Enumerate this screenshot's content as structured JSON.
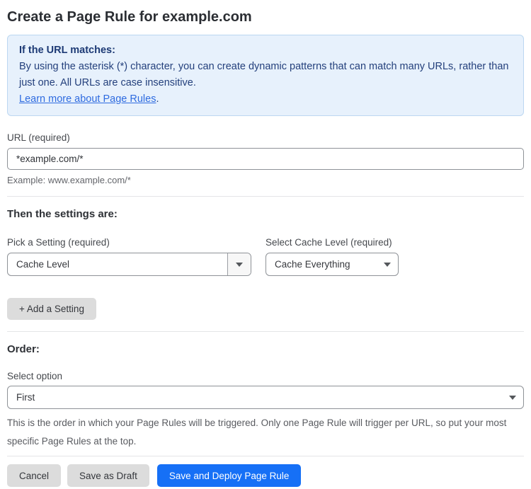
{
  "page": {
    "title": "Create a Page Rule for example.com"
  },
  "info_box": {
    "heading": "If the URL matches:",
    "body": "By using the asterisk (*) character, you can create dynamic patterns that can match many URLs, rather than just one. All URLs are case insensitive.",
    "link_label": "Learn more about Page Rules",
    "link_suffix": "."
  },
  "url_field": {
    "label": "URL (required)",
    "value": "*example.com/*",
    "helper": "Example: www.example.com/*"
  },
  "settings_section": {
    "heading": "Then the settings are:",
    "setting_picker": {
      "label": "Pick a Setting (required)",
      "value": "Cache Level"
    },
    "cache_level_picker": {
      "label": "Select Cache Level (required)",
      "value": "Cache Everything"
    },
    "add_setting_label": "+ Add a Setting"
  },
  "order_section": {
    "heading": "Order:",
    "label": "Select option",
    "value": "First",
    "helper": "This is the order in which your Page Rules will be triggered. Only one Page Rule will trigger per URL, so put your most specific Page Rules at the top."
  },
  "footer": {
    "cancel_label": "Cancel",
    "save_draft_label": "Save as Draft",
    "save_deploy_label": "Save and Deploy Page Rule"
  },
  "icons": {
    "dropdown_arrow": "caret-down"
  },
  "colors": {
    "info_bg": "#e7f1fc",
    "info_border": "#bcd7f1",
    "info_text": "#24407c",
    "link": "#2e6be0",
    "primary_button": "#1670f6",
    "gray_button": "#dcdcdc",
    "input_border": "#8e9297"
  }
}
